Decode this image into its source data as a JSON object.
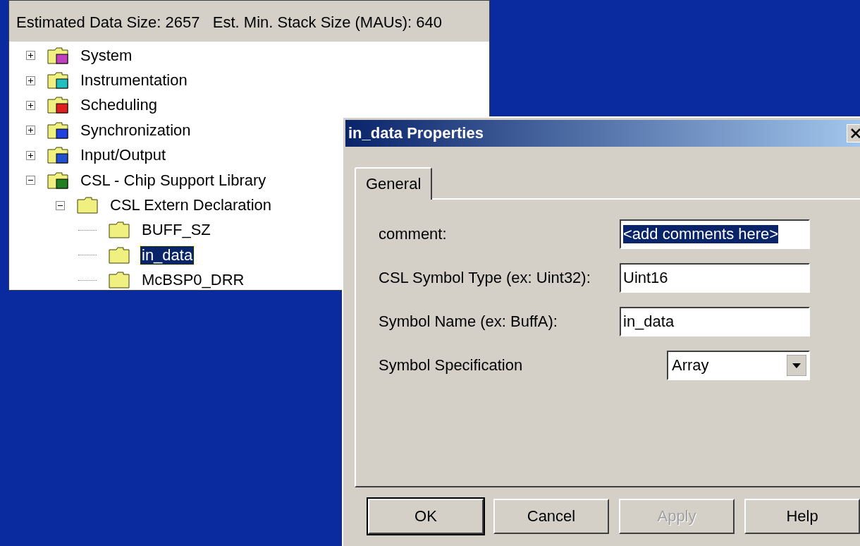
{
  "tree_panel": {
    "status": "Estimated Data Size: 2657   Est. Min. Stack Size (MAUs): 640",
    "tree": [
      {
        "label": "System",
        "expanded": false,
        "selected": false
      },
      {
        "label": "Instrumentation",
        "expanded": false,
        "selected": false
      },
      {
        "label": "Scheduling",
        "expanded": false,
        "selected": false
      },
      {
        "label": "Synchronization",
        "expanded": false,
        "selected": false
      },
      {
        "label": "Input/Output",
        "expanded": false,
        "selected": false
      },
      {
        "label": "CSL - Chip Support Library",
        "expanded": true,
        "selected": false,
        "children": [
          {
            "label": "CSL Extern Declaration",
            "expanded": true,
            "selected": false,
            "children": [
              {
                "label": "BUFF_SZ",
                "selected": false
              },
              {
                "label": "in_data",
                "selected": true
              },
              {
                "label": "McBSP0_DRR",
                "selected": false
              }
            ]
          }
        ]
      }
    ]
  },
  "dialog": {
    "title": "in_data Properties",
    "tabs": [
      {
        "label": "General",
        "selected": true
      }
    ],
    "fields": [
      {
        "kind": "text",
        "label": "comment:",
        "value": "<add comments here>",
        "highlighted": true
      },
      {
        "kind": "text",
        "label": "CSL Symbol Type (ex: Uint32):",
        "value": "Uint16",
        "highlighted": false
      },
      {
        "kind": "text",
        "label": "Symbol Name (ex: BuffA):",
        "value": "in_data",
        "highlighted": false
      },
      {
        "kind": "dropdown",
        "label": "Symbol Specification",
        "value": "Array",
        "highlighted": false
      }
    ],
    "buttons": [
      {
        "label": "OK",
        "default": true,
        "disabled": false
      },
      {
        "label": "Cancel",
        "default": false,
        "disabled": false
      },
      {
        "label": "Apply",
        "default": false,
        "disabled": true
      },
      {
        "label": "Help",
        "default": false,
        "disabled": false
      }
    ]
  }
}
